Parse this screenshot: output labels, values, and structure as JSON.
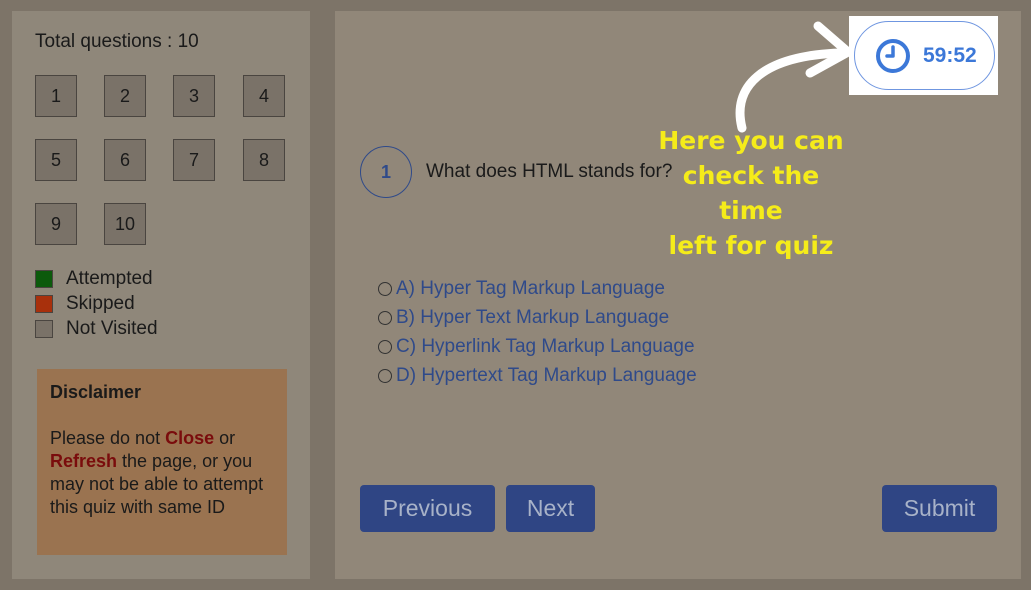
{
  "sidebar": {
    "total_label": "Total questions : 10",
    "questions": [
      "1",
      "2",
      "3",
      "4",
      "5",
      "6",
      "7",
      "8",
      "9",
      "10"
    ],
    "legend": [
      {
        "label": "Attempted",
        "color": "#0c5a0c"
      },
      {
        "label": "Skipped",
        "color": "#a8300c"
      },
      {
        "label": "Not Visited",
        "color": "#7a7268"
      }
    ],
    "disclaimer": {
      "title": "Disclaimer",
      "part1": "Please do not ",
      "close": "Close",
      "part2": " or ",
      "refresh": "Refresh",
      "part3": " the page, or you may not be able to attempt this quiz with same ID"
    }
  },
  "main": {
    "question_number": "1",
    "question_text": "What does HTML stands for?",
    "options": [
      "A) Hyper Tag Markup Language",
      "B) Hyper Text Markup Language",
      "C) Hyperlink Tag Markup Language",
      "D) Hypertext Tag Markup Language"
    ],
    "buttons": {
      "previous": "Previous",
      "next": "Next",
      "submit": "Submit"
    }
  },
  "timer": {
    "time": "59:52",
    "icon": "clock-icon",
    "accent": "#3c78d8"
  },
  "annotation": {
    "line1": "Here you can",
    "line2": "check the time",
    "line3": "left for quiz",
    "color": "#f5ec1a"
  }
}
